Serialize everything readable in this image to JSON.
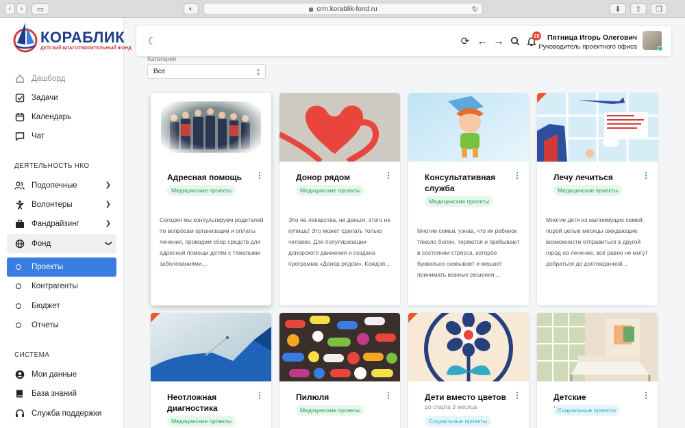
{
  "browser": {
    "url": "crm.korablik-fond.ru"
  },
  "logo": {
    "title": "КОРАБЛИК",
    "subtitle": "ДЕТСКИЙ БЛАГОТВОРИТЕЛЬНЫЙ ФОНД"
  },
  "sidebar": {
    "main": [
      {
        "label": "Дашборд",
        "icon": "home-icon"
      },
      {
        "label": "Задачи",
        "icon": "checkbox-icon"
      },
      {
        "label": "Календарь",
        "icon": "calendar-icon"
      },
      {
        "label": "Чат",
        "icon": "chat-icon"
      }
    ],
    "section_nko": "ДЕЯТЕЛЬНОСТЬ НКО",
    "nko": [
      {
        "label": "Подопечные",
        "icon": "users-icon"
      },
      {
        "label": "Волонтеры",
        "icon": "volunteer-icon"
      },
      {
        "label": "Фандрайзинг",
        "icon": "briefcase-icon"
      },
      {
        "label": "Фонд",
        "icon": "globe-icon"
      }
    ],
    "fund_sub": [
      {
        "label": "Проекты"
      },
      {
        "label": "Контрагенты"
      },
      {
        "label": "Бюджет"
      },
      {
        "label": "Отчеты"
      }
    ],
    "section_system": "СИСТЕМА",
    "system": [
      {
        "label": "Мои данные",
        "icon": "user-circle-icon"
      },
      {
        "label": "База знаний",
        "icon": "book-icon"
      },
      {
        "label": "Служба поддержки",
        "icon": "support-icon"
      }
    ]
  },
  "topbar": {
    "notifications_count": "25",
    "user_name": "Пятница Игорь Олегович",
    "user_role": "Руководитель проектного офиса"
  },
  "filter": {
    "label": "Категория",
    "value": "Все"
  },
  "accent_color": "#3a7de0",
  "cards": [
    {
      "title": "Адресная помощь",
      "tag": "Медицинские проекты",
      "desc": "Сегодня мы консультируем родителей по вопросам организации и оплаты лечения, проводим сбор средств для адресной помощи детям с тяжелыми заболеваниями,..."
    },
    {
      "title": "Донор рядом",
      "tag": "Медицинские проекты",
      "desc": "Это не лекарства, не деньги, этого не купишь! Это может сделать только человек. Для популяризации донорского движения и создана программа «Донор рядом». Каждая..."
    },
    {
      "title": "Консультативная служба",
      "tag": "Медицинские проекты",
      "desc": "Многие семьи, узнав, что их ребенок тяжело болен, теряются и пребывают в состоянии стресса, которое буквально сковывает и мешает принимать важные решения...."
    },
    {
      "title": "Лечу лечиться",
      "tag": "Медицинские проекты",
      "desc": "Многие дети из малоимущих семей, порой целые месяцы ожидающие возможности отправиться в другой город на лечение, всё равно не могут добраться до долгожданной..."
    },
    {
      "title": "Неотложная диагностика",
      "tag": "Медицинские проекты"
    },
    {
      "title": "Пилюля",
      "tag": "Медицинские проекты"
    },
    {
      "title": "Дети вместо цветов",
      "subtitle": "до старта 3 месяца",
      "tag": "Социальные проекты"
    },
    {
      "title": "Детские пространства",
      "tag": "Социальные проекты"
    }
  ]
}
